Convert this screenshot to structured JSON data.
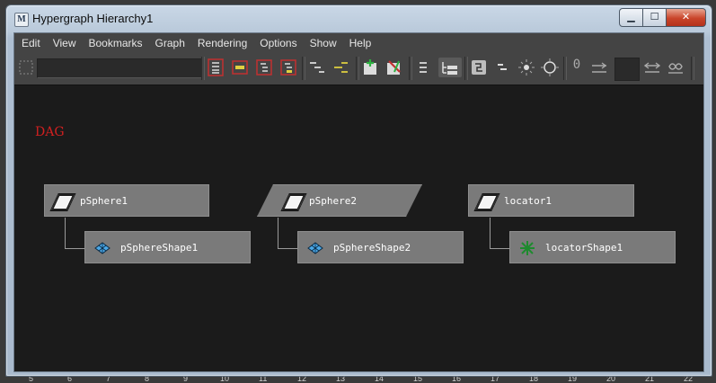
{
  "window": {
    "title": "Hypergraph Hierarchy1",
    "buttons": {
      "minimize": "▁",
      "maximize": "☐",
      "close": "✕"
    }
  },
  "menubar": [
    "Edit",
    "View",
    "Bookmarks",
    "Graph",
    "Rendering",
    "Options",
    "Show",
    "Help"
  ],
  "toolbar": {
    "search_value": "",
    "number_hint": "0",
    "icons": [
      "input-connections-icon",
      "clear-graph-icon",
      "scene-hierarchy-icon",
      "graph-selection-icon",
      "collapse-icon",
      "expand-icon",
      "add-bookmark-icon",
      "remove-bookmark-icon",
      "list-view-icon",
      "hierarchy-view-icon",
      "frame-all-icon",
      "frame-selection-icon",
      "layout-icon",
      "layout-radial-icon",
      "zoom-0-icon",
      "dependency-icon",
      "dependency2-icon",
      "infinity-icon"
    ]
  },
  "graph": {
    "section_label": "DAG",
    "nodes": [
      {
        "name": "pSphere1",
        "type": "transform",
        "selected": false
      },
      {
        "name": "pSphereShape1",
        "type": "mesh"
      },
      {
        "name": "pSphere2",
        "type": "transform",
        "selected": true
      },
      {
        "name": "pSphereShape2",
        "type": "mesh"
      },
      {
        "name": "locator1",
        "type": "transform",
        "selected": false
      },
      {
        "name": "locatorShape1",
        "type": "locator"
      }
    ]
  },
  "ruler": [
    "5",
    "6",
    "7",
    "8",
    "9",
    "10",
    "11",
    "12",
    "13",
    "14",
    "15",
    "16",
    "17",
    "18",
    "19",
    "20",
    "21",
    "22"
  ],
  "colors": {
    "canvas": "#1b1b1b",
    "node": "#7a7a7a",
    "dag_label": "#d02020",
    "close_button": "#c9442a"
  }
}
